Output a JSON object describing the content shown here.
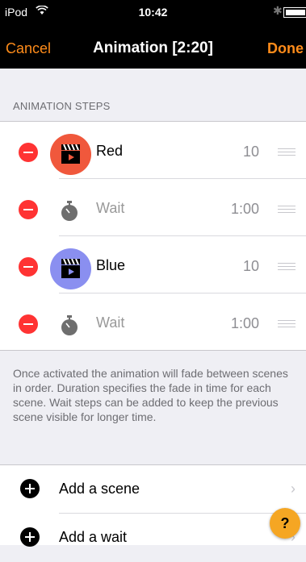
{
  "status_bar": {
    "carrier": "iPod",
    "time": "10:42",
    "bluetooth": "✱"
  },
  "nav": {
    "cancel": "Cancel",
    "title": "Animation [2:20]",
    "done": "Done"
  },
  "steps_section": {
    "header": "ANIMATION STEPS",
    "steps": [
      {
        "label": "Red",
        "value": "10",
        "type": "scene",
        "color": "#f0583c"
      },
      {
        "label": "Wait",
        "value": "1:00",
        "type": "wait"
      },
      {
        "label": "Blue",
        "value": "10",
        "type": "scene",
        "color": "#8a8ff0"
      },
      {
        "label": "Wait",
        "value": "1:00",
        "type": "wait"
      }
    ]
  },
  "description": "Once activated the animation will fade between scenes in order. Duration specifies the fade in time for each scene. Wait steps can be added to keep the previous scene visible for longer time.",
  "actions": [
    {
      "label": "Add a scene",
      "chevron": "›"
    },
    {
      "label": "Add a wait",
      "chevron": "›"
    }
  ],
  "help_button": "?",
  "colors": {
    "accent": "#ff8c1a",
    "delete": "#ff3333",
    "help": "#f5a623"
  }
}
